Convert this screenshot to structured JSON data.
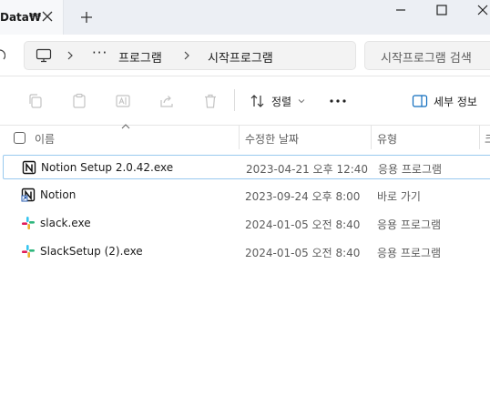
{
  "window": {
    "tab_title": "Data₩",
    "icons": {
      "tab_close": "close-icon",
      "new_tab": "plus-icon",
      "minimize": "minimize-icon",
      "maximize": "maximize-icon",
      "close": "close-icon"
    }
  },
  "address": {
    "root_icon": "computer-icon",
    "overflow": "···",
    "crumbs": [
      "프로그램",
      "시작프로그램"
    ],
    "search_placeholder": "시작프로그램 검색"
  },
  "toolbar": {
    "icons": [
      "copy-icon",
      "paste-icon",
      "rename-icon",
      "share-icon",
      "delete-icon"
    ],
    "sort_label": "정렬",
    "more_label": "···",
    "details_label": "세부 정보"
  },
  "columns": {
    "name": "이름",
    "modified": "수정한 날짜",
    "type": "유형",
    "size_partial": "크"
  },
  "files": [
    {
      "name": "Notion Setup 2.0.42.exe",
      "modified": "2023-04-21 오후 12:40",
      "type": "응용 프로그램",
      "icon": "notion-icon",
      "selected": true
    },
    {
      "name": "Notion",
      "modified": "2023-09-24 오후 8:00",
      "type": "바로 가기",
      "icon": "notion-shortcut-icon",
      "selected": false
    },
    {
      "name": "slack.exe",
      "modified": "2024-01-05 오전 8:40",
      "type": "응용 프로그램",
      "icon": "slack-icon",
      "selected": false
    },
    {
      "name": "SlackSetup (2).exe",
      "modified": "2024-01-05 오전 8:40",
      "type": "응용 프로그램",
      "icon": "slack-icon",
      "selected": false
    }
  ],
  "colors": {
    "accent_selection": "#99c9ef",
    "slack_blue": "#36c5f0",
    "slack_green": "#2eb67d",
    "slack_yellow": "#ecb22e",
    "slack_red": "#e01e5a"
  }
}
